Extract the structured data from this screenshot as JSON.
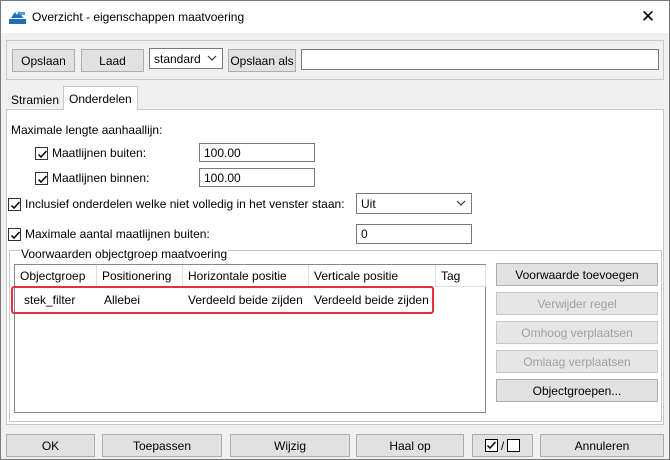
{
  "window": {
    "title": "Overzicht - eigenschappen maatvoering",
    "close_glyph": "✕"
  },
  "toolbar": {
    "save_label": "Opslaan",
    "load_label": "Laad",
    "preset_value": "standard",
    "save_as_label": "Opslaan als",
    "save_as_name": ""
  },
  "tabs": [
    {
      "label": "Stramien"
    },
    {
      "label": "Onderdelen"
    }
  ],
  "panel": {
    "max_length_heading": "Maximale lengte aanhaallijn:",
    "outer_lines_label": "Maatlijnen buiten:",
    "outer_lines_value": "100.00",
    "outer_lines_checked": true,
    "inner_lines_label": "Maatlijnen binnen:",
    "inner_lines_value": "100.00",
    "inner_lines_checked": true,
    "include_partial_label": "Inclusief onderdelen welke niet volledig in het venster staan:",
    "include_partial_checked": true,
    "include_partial_value": "Uit",
    "max_outer_count_label": "Maximale aantal maatlijnen buiten:",
    "max_outer_count_checked": true,
    "max_outer_count_value": "0"
  },
  "conditions": {
    "legend": "Voorwaarden objectgroep maatvoering",
    "columns": [
      "Objectgroep",
      "Positionering",
      "Horizontale positie",
      "Verticale positie",
      "Tag"
    ],
    "rows": [
      [
        "stek_filter",
        "Allebei",
        "Verdeeld beide zijden",
        "Verdeeld beide zijden",
        ""
      ]
    ],
    "buttons": {
      "add": "Voorwaarde toevoegen",
      "remove": "Verwijder regel",
      "move_up": "Omhoog verplaatsen",
      "move_down": "Omlaag verplaatsen",
      "object_groups": "Objectgroepen..."
    }
  },
  "footer": {
    "ok": "OK",
    "apply": "Toepassen",
    "modify": "Wijzig",
    "get": "Haal op",
    "toggle_separator": "/",
    "cancel": "Annuleren"
  },
  "colors": {
    "highlight": "#e0303a",
    "window_bg": "#f0f0f0",
    "accent_icon": "#1e6fb8"
  }
}
